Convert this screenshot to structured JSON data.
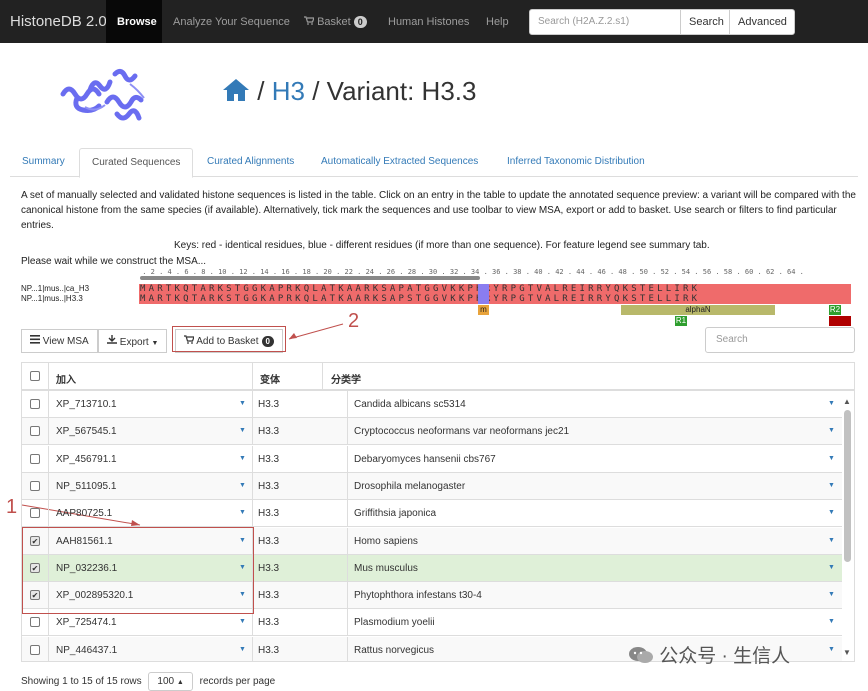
{
  "navbar": {
    "brand": "HistoneDB 2.0",
    "items": {
      "browse": "Browse",
      "analyze": "Analyze Your Sequence",
      "basket": "Basket",
      "basket_count": "0",
      "human": "Human Histones",
      "help": "Help"
    },
    "search_placeholder": "Search (H2A.Z.2.s1)",
    "search_button": "Search",
    "advanced_button": "Advanced"
  },
  "header": {
    "separator1": "/",
    "h3_link": "H3",
    "separator2": "/",
    "variant": "Variant: H3.3"
  },
  "tabs": {
    "summary": "Summary",
    "curated_sequences": "Curated Sequences",
    "curated_alignments": "Curated Alignments",
    "auto_sequences": "Automatically Extracted Sequences",
    "taxonomic": "Inferred Taxonomic Distribution"
  },
  "description": "A set of manually selected and validated histone sequences is listed in the table. Click on an entry in the table to update the annotated sequence preview: a variant will be compared with the canonical histone from the same species (if available). Alternatively, tick mark the sequences and use toolbar to view MSA, export or add to basket. Use search or filters to find particular entries.",
  "keys_text": "Keys: red - identical residues, blue - different residues (if more than one sequence). For feature legend see summary tab.",
  "wait_text": "Please wait while we construct the MSA...",
  "sequence_viewer": {
    "ruler": " . 2 . 4 . 6 . 8 . 10 . 12 . 14 . 16 . 18 . 20 . 22 . 24 . 26 . 28 . 30 . 32 . 34 . 36 . 38 . 40 . 42 . 44 . 46 . 48 . 50 . 52 . 54 . 56 . 58 . 60 . 62 . 64 .",
    "rows": [
      {
        "label": "NP...1|mus..|ca_H3",
        "sequence": "MARTKQTARKSTGGKAPRKQLATKAARKSAPATGGVKKPHRYRPGTVALREIRRYQKSTELLIRK"
      },
      {
        "label": "NP...1|mus..|H3.3",
        "sequence": "MARTKQTARKSTGGKAPRKQLATKAARKSAPSTGGVKKPHRYRPGTVALREIRRYQKSTELLIRK"
      }
    ],
    "features": {
      "m": "m",
      "alphaN": "alphaN",
      "r1": "R1",
      "r2": "R2"
    }
  },
  "toolbar": {
    "view_msa": "View MSA",
    "export": "Export",
    "add_to_basket": "Add to Basket",
    "basket_count": "0",
    "search_placeholder": "Search"
  },
  "annotations": {
    "one": "1",
    "two": "2"
  },
  "table": {
    "columns": [
      "加入",
      "变体",
      "分类学"
    ],
    "rows": [
      {
        "accession": "XP_713710.1",
        "variant": "H3.3",
        "taxonomy": "Candida albicans sc5314",
        "checked": false
      },
      {
        "accession": "XP_567545.1",
        "variant": "H3.3",
        "taxonomy": "Cryptococcus neoformans var neoformans jec21",
        "checked": false
      },
      {
        "accession": "XP_456791.1",
        "variant": "H3.3",
        "taxonomy": "Debaryomyces hansenii cbs767",
        "checked": false
      },
      {
        "accession": "NP_511095.1",
        "variant": "H3.3",
        "taxonomy": "Drosophila melanogaster",
        "checked": false
      },
      {
        "accession": "AAP80725.1",
        "variant": "H3.3",
        "taxonomy": "Griffithsia japonica",
        "checked": false
      },
      {
        "accession": "AAH81561.1",
        "variant": "H3.3",
        "taxonomy": "Homo sapiens",
        "checked": true
      },
      {
        "accession": "NP_032236.1",
        "variant": "H3.3",
        "taxonomy": "Mus musculus",
        "checked": true
      },
      {
        "accession": "XP_002895320.1",
        "variant": "H3.3",
        "taxonomy": "Phytophthora infestans t30-4",
        "checked": true
      },
      {
        "accession": "XP_725474.1",
        "variant": "H3.3",
        "taxonomy": "Plasmodium yoelii",
        "checked": false
      },
      {
        "accession": "NP_446437.1",
        "variant": "H3.3",
        "taxonomy": "Rattus norvegicus",
        "checked": false
      }
    ]
  },
  "footer": {
    "showing": "Showing 1 to 15 of 15 rows",
    "page_size": "100",
    "records_per_page": "records per page"
  },
  "watermark": "公众号 · 生信人",
  "colors": {
    "navbar": "#222222",
    "link": "#337ab7",
    "identical": "#ef6b6b",
    "different": "#8a7df0",
    "highlight_row": "#dff0d8",
    "annotation": "#c0504d"
  }
}
